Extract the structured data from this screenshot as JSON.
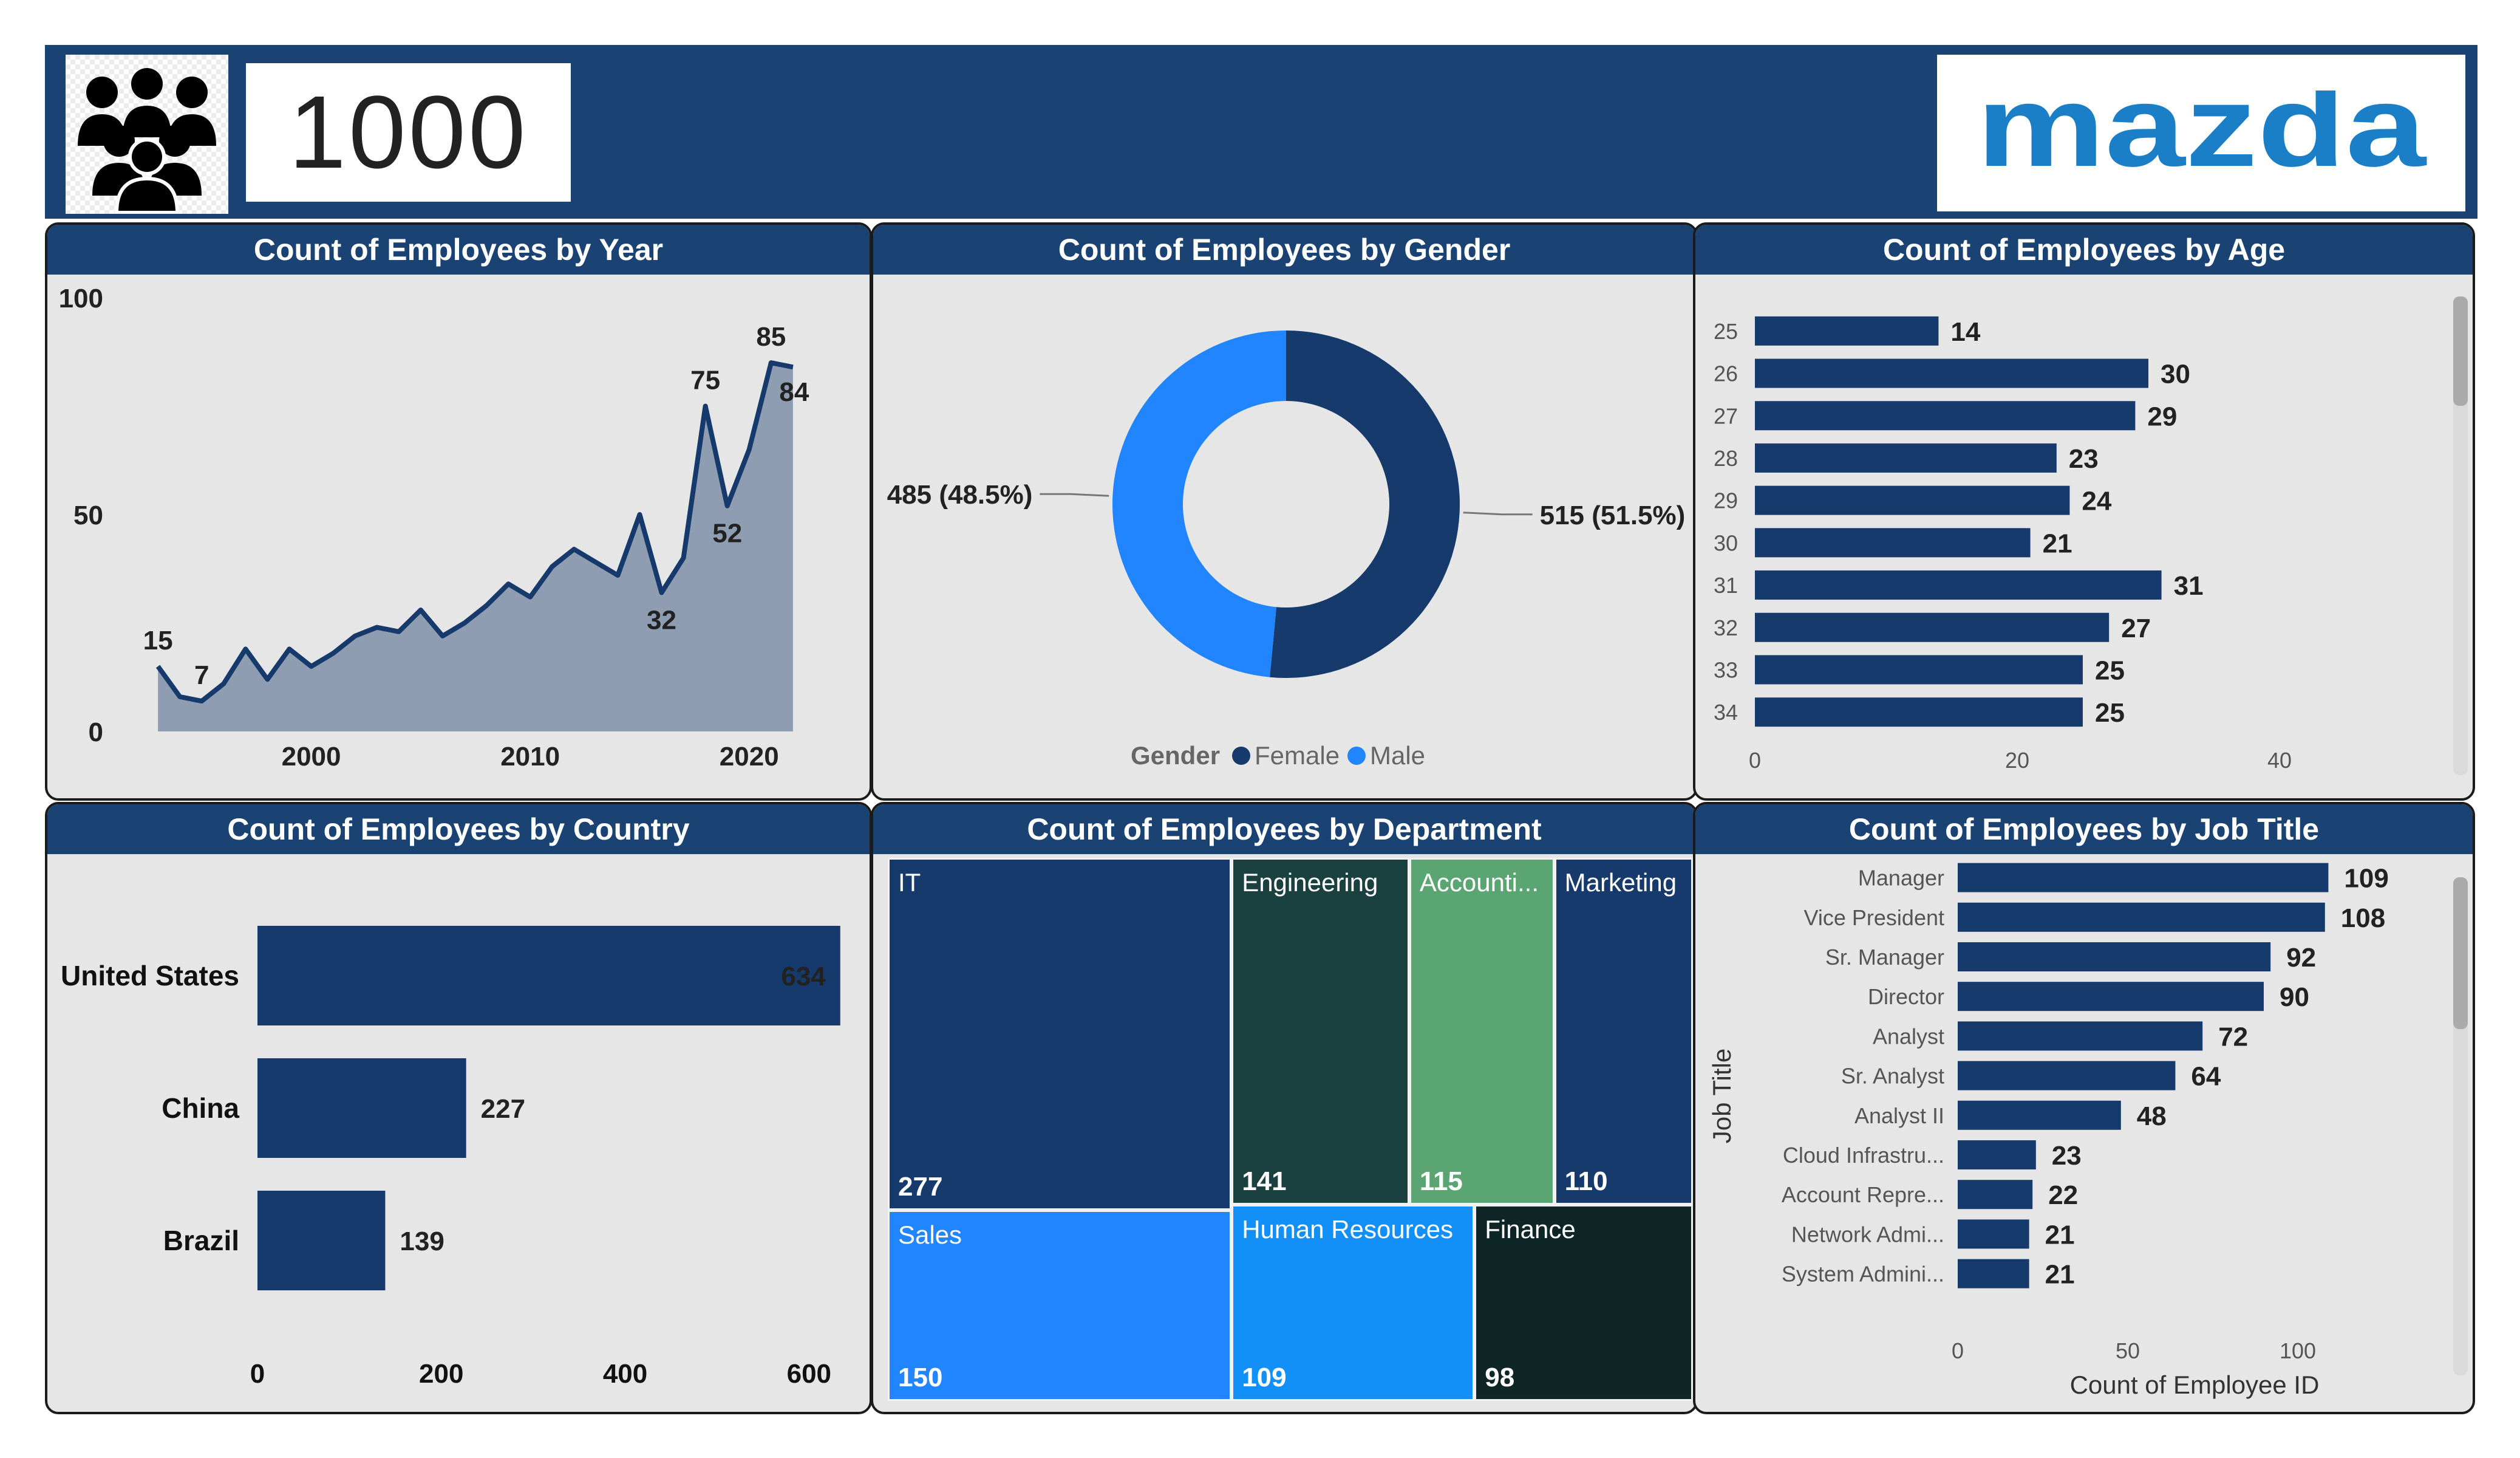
{
  "kpi": {
    "total_employees": "1000",
    "people_icon": "people-group-icon"
  },
  "brand": {
    "logo_text": "mazda",
    "logo_color": "#1a7fc6"
  },
  "colors": {
    "header": "#1a4272",
    "dark_blue": "#163a6b",
    "bright_blue": "#2185ff",
    "panel_bg": "#e6e6e6"
  },
  "panels": {
    "year": {
      "title": "Count of Employees by Year"
    },
    "gender": {
      "title": "Count of Employees by Gender"
    },
    "age": {
      "title": "Count of Employees by Age"
    },
    "country": {
      "title": "Count of Employees by Country"
    },
    "department": {
      "title": "Count of Employees by Department"
    },
    "job": {
      "title": "Count of Employees by Job Title"
    }
  },
  "chart_data": [
    {
      "id": "year",
      "type": "area",
      "title": "Count of Employees by Year",
      "x": [
        1993,
        1994,
        1995,
        1996,
        1997,
        1998,
        1999,
        2000,
        2001,
        2002,
        2003,
        2004,
        2005,
        2006,
        2007,
        2008,
        2009,
        2010,
        2011,
        2012,
        2013,
        2014,
        2015,
        2016,
        2017,
        2018,
        2019,
        2020,
        2021,
        2022
      ],
      "values": [
        15,
        8,
        7,
        11,
        19,
        12,
        19,
        15,
        18,
        22,
        24,
        23,
        28,
        22,
        25,
        29,
        34,
        31,
        38,
        42,
        39,
        36,
        50,
        32,
        40,
        75,
        52,
        65,
        85,
        84
      ],
      "data_labels": [
        {
          "x": 1993,
          "label": "15"
        },
        {
          "x": 1995,
          "label": "7"
        },
        {
          "x": 2016,
          "label": "32"
        },
        {
          "x": 2018,
          "label": "75"
        },
        {
          "x": 2019,
          "label": "52"
        },
        {
          "x": 2021,
          "label": "85"
        },
        {
          "x": 2022,
          "label": "84"
        }
      ],
      "x_ticks": [
        "2000",
        "2010",
        "2020"
      ],
      "y_ticks": [
        "0",
        "50",
        "100"
      ],
      "ylim": [
        0,
        100
      ],
      "xlim": [
        1991,
        2024
      ],
      "color": "#163a6b"
    },
    {
      "id": "gender",
      "type": "pie",
      "title": "Count of Employees by Gender",
      "legend_title": "Gender",
      "legend_position": "bottom",
      "slices": [
        {
          "name": "Female",
          "value": 515,
          "label": "515 (51.5%)",
          "color": "#163a6b"
        },
        {
          "name": "Male",
          "value": 485,
          "label": "485 (48.5%)",
          "color": "#2185ff"
        }
      ]
    },
    {
      "id": "age",
      "type": "bar",
      "orientation": "horizontal",
      "title": "Count of Employees by Age",
      "categories": [
        "25",
        "26",
        "27",
        "28",
        "29",
        "30",
        "31",
        "32",
        "33",
        "34"
      ],
      "values": [
        14,
        30,
        29,
        23,
        24,
        21,
        31,
        27,
        25,
        25
      ],
      "x_ticks": [
        "0",
        "20",
        "40"
      ],
      "xlim": [
        0,
        50
      ],
      "color": "#163a6b"
    },
    {
      "id": "country",
      "type": "bar",
      "orientation": "horizontal",
      "title": "Count of Employees by Country",
      "categories": [
        "United States",
        "China",
        "Brazil"
      ],
      "values": [
        634,
        227,
        139
      ],
      "x_ticks": [
        "0",
        "200",
        "400",
        "600"
      ],
      "xlim": [
        0,
        650
      ],
      "color": "#163a6b"
    },
    {
      "id": "department",
      "type": "treemap",
      "title": "Count of Employees by Department",
      "items": [
        {
          "name": "IT",
          "label": "IT",
          "value": 277,
          "color": "#163a6b"
        },
        {
          "name": "Sales",
          "label": "Sales",
          "value": 150,
          "color": "#2185ff"
        },
        {
          "name": "Engineering",
          "label": "Engineering",
          "value": 141,
          "color": "#1a4040"
        },
        {
          "name": "Accounting",
          "label": "Accounti...",
          "value": 115,
          "color": "#5aa572"
        },
        {
          "name": "Marketing",
          "label": "Marketing",
          "value": 110,
          "color": "#163a6b"
        },
        {
          "name": "Human Resources",
          "label": "Human Resources",
          "value": 109,
          "color": "#1290f8"
        },
        {
          "name": "Finance",
          "label": "Finance",
          "value": 98,
          "color": "#0f2626"
        }
      ]
    },
    {
      "id": "job",
      "type": "bar",
      "orientation": "horizontal",
      "title": "Count of Employees by Job Title",
      "categories": [
        "Manager",
        "Vice President",
        "Sr. Manager",
        "Director",
        "Analyst",
        "Sr. Analyst",
        "Analyst II",
        "Cloud Infrastru...",
        "Account Repre...",
        "Network Admi...",
        "System Admini..."
      ],
      "values": [
        109,
        108,
        92,
        90,
        72,
        64,
        48,
        23,
        22,
        21,
        21
      ],
      "x_ticks": [
        "0",
        "50",
        "100"
      ],
      "xlim": [
        0,
        125
      ],
      "xlabel": "Count of Employee ID",
      "ylabel": "Job Title",
      "color": "#163a6b"
    }
  ]
}
